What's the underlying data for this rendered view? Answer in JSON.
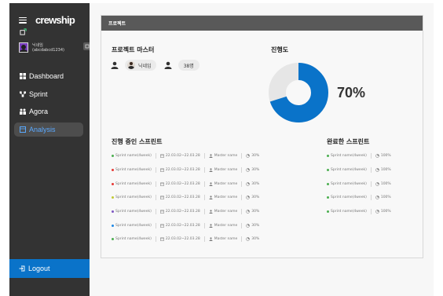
{
  "sidebar": {
    "logo": "crewship",
    "profile": {
      "name": "닉네임",
      "id": "(abcdabcd1234)"
    },
    "nav": [
      {
        "label": "Dashboard",
        "icon": "dashboard-icon",
        "active": false
      },
      {
        "label": "Sprint",
        "icon": "sprint-icon",
        "active": false
      },
      {
        "label": "Agora",
        "icon": "agora-icon",
        "active": false
      },
      {
        "label": "Analysis",
        "icon": "analysis-icon",
        "active": true
      }
    ],
    "logout_label": "Logout"
  },
  "card": {
    "title": "프로젝트",
    "master_title": "프로젝트 마스터",
    "master_name": "닉네임",
    "member_count": "38명",
    "progress_title": "진행도",
    "progress_value": 0.7,
    "progress_text": "70%",
    "ongoing_title": "진행 중인 스프린트",
    "done_title": "완료한 스프린트"
  },
  "ongoing_sprints": [
    {
      "name": "Sprint name(4week)",
      "dates": "22.03.02~22.03.28",
      "master": "Master name",
      "progress": "30%",
      "color": "#4caf50"
    },
    {
      "name": "Sprint name(4week)",
      "dates": "22.03.02~22.03.28",
      "master": "Master name",
      "progress": "30%",
      "color": "#e53935"
    },
    {
      "name": "Sprint name(4week)",
      "dates": "22.03.02~22.03.28",
      "master": "Master name",
      "progress": "30%",
      "color": "#e53935"
    },
    {
      "name": "Sprint name(4week)",
      "dates": "22.03.02~22.03.28",
      "master": "Master name",
      "progress": "30%",
      "color": "#c0ca33"
    },
    {
      "name": "Sprint name(4week)",
      "dates": "22.03.02~22.03.28",
      "master": "Master name",
      "progress": "30%",
      "color": "#7e57c2"
    },
    {
      "name": "Sprint name(4week)",
      "dates": "22.03.02~22.03.28",
      "master": "Master name",
      "progress": "30%",
      "color": "#1e88e5"
    },
    {
      "name": "Sprint name(4week)",
      "dates": "22.03.02~22.03.28",
      "master": "Master name",
      "progress": "30%",
      "color": "#4caf50"
    }
  ],
  "completed_sprints": [
    {
      "name": "Sprint name(4week)",
      "progress": "100%",
      "color": "#4caf50"
    },
    {
      "name": "Sprint name(4week)",
      "progress": "100%",
      "color": "#4caf50"
    },
    {
      "name": "Sprint name(4week)",
      "progress": "100%",
      "color": "#4caf50"
    },
    {
      "name": "Sprint name(4week)",
      "progress": "100%",
      "color": "#4caf50"
    },
    {
      "name": "Sprint name(4week)",
      "progress": "100%",
      "color": "#4caf50"
    }
  ],
  "colors": {
    "accent": "#0a73c9",
    "donut_fill": "#0a73c9",
    "donut_track": "#e6e6e6",
    "sidebar": "#333333"
  }
}
